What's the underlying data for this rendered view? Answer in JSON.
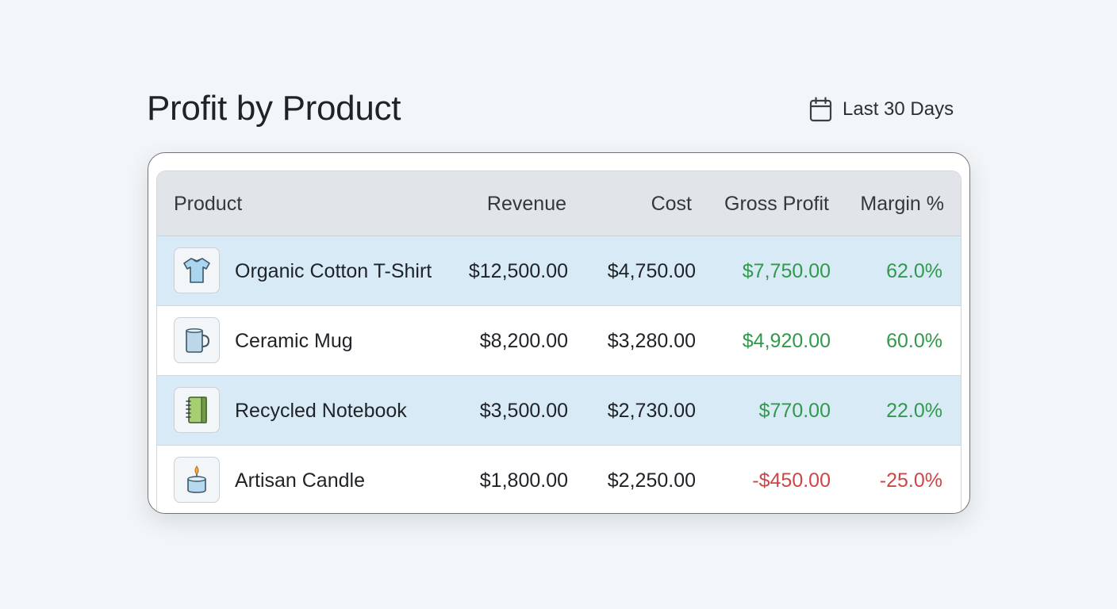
{
  "header": {
    "title": "Profit by Product",
    "date_range": "Last 30 Days",
    "date_icon": "calendar-icon"
  },
  "table": {
    "columns": [
      "Product",
      "Revenue",
      "Cost",
      "Gross Profit",
      "Margin %"
    ],
    "rows": [
      {
        "icon": "tshirt-icon",
        "product": "Organic Cotton T-Shirt",
        "revenue": "$12,500.00",
        "cost": "$4,750.00",
        "gross_profit": "$7,750.00",
        "margin": "62.0%",
        "status": "positive"
      },
      {
        "icon": "mug-icon",
        "product": "Ceramic Mug",
        "revenue": "$8,200.00",
        "cost": "$3,280.00",
        "gross_profit": "$4,920.00",
        "margin": "60.0%",
        "status": "positive"
      },
      {
        "icon": "notebook-icon",
        "product": "Recycled Notebook",
        "revenue": "$3,500.00",
        "cost": "$2,730.00",
        "gross_profit": "$770.00",
        "margin": "22.0%",
        "status": "positive"
      },
      {
        "icon": "candle-icon",
        "product": "Artisan Candle",
        "revenue": "$1,800.00",
        "cost": "$2,250.00",
        "gross_profit": "-$450.00",
        "margin": "-25.0%",
        "status": "negative"
      }
    ]
  },
  "colors": {
    "positive": "#2f9a4b",
    "negative": "#d04545",
    "row_highlight": "#d8eaf6",
    "header_bg": "#e1e4e8"
  }
}
